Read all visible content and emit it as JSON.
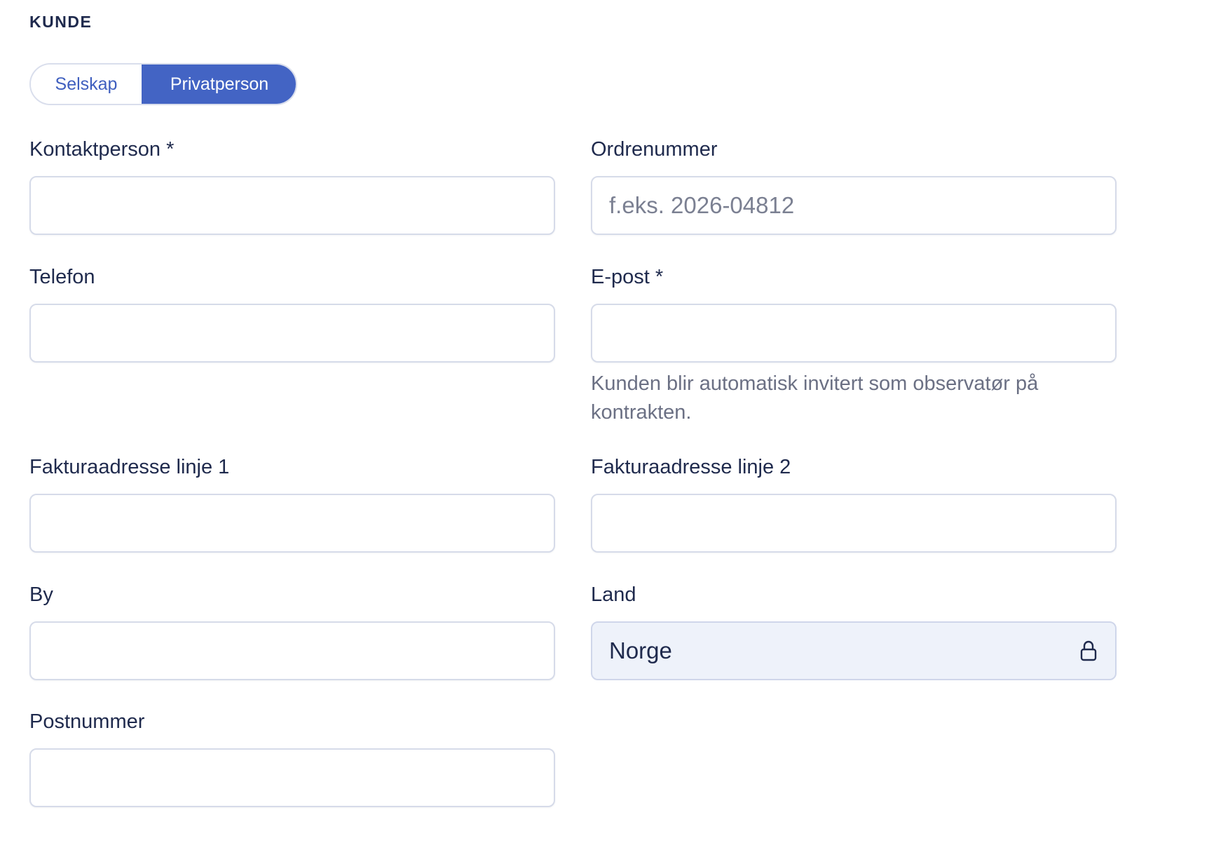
{
  "section": {
    "title": "KUNDE"
  },
  "customer_type": {
    "options": [
      "Selskap",
      "Privatperson"
    ],
    "selected": "Privatperson"
  },
  "fields": {
    "kontaktperson": {
      "label": "Kontaktperson *",
      "value": "",
      "placeholder": ""
    },
    "ordrenummer": {
      "label": "Ordrenummer",
      "value": "",
      "placeholder": "f.eks. 2026-04812"
    },
    "telefon": {
      "label": "Telefon",
      "value": "",
      "placeholder": ""
    },
    "epost": {
      "label": "E-post *",
      "value": "",
      "placeholder": "",
      "helper": "Kunden blir automatisk invitert som observatør på kontrakten."
    },
    "faktura1": {
      "label": "Fakturaadresse linje 1",
      "value": "",
      "placeholder": ""
    },
    "faktura2": {
      "label": "Fakturaadresse linje 2",
      "value": "",
      "placeholder": ""
    },
    "by": {
      "label": "By",
      "value": "",
      "placeholder": ""
    },
    "land": {
      "label": "Land",
      "value": "Norge",
      "locked": true,
      "icon": "lock-icon"
    },
    "postnummer": {
      "label": "Postnummer",
      "value": "",
      "placeholder": ""
    }
  },
  "colors": {
    "accent": "#4364c4",
    "text": "#1f2a4d",
    "muted": "#6b7084",
    "border": "#d6dbe9",
    "locked_bg": "#eef2fa"
  }
}
